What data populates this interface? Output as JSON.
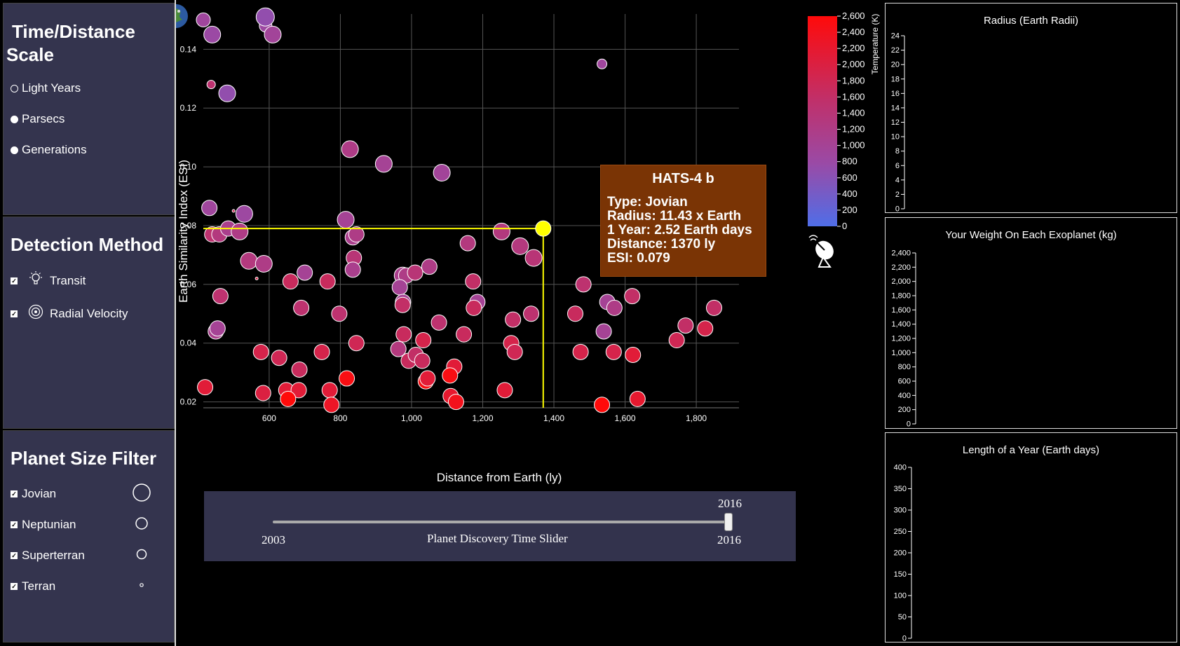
{
  "scale_panel": {
    "title": "Time/Distance Scale",
    "title_line1": "Time/Distance",
    "title_line2": "Scale",
    "options": [
      {
        "label": "Light Years",
        "selected": true
      },
      {
        "label": "Parsecs",
        "selected": false
      },
      {
        "label": "Generations",
        "selected": false
      }
    ]
  },
  "detection_panel": {
    "title": "Detection Method",
    "options": [
      {
        "label": "Transit",
        "checked": true,
        "icon": "lightbulb-icon"
      },
      {
        "label": "Radial Velocity",
        "checked": true,
        "icon": "radial-wave-icon"
      }
    ]
  },
  "size_panel": {
    "title": "Planet Size Filter",
    "options": [
      {
        "label": "Jovian",
        "checked": true
      },
      {
        "label": "Neptunian",
        "checked": true
      },
      {
        "label": "Superterran",
        "checked": true
      },
      {
        "label": "Terran",
        "checked": true
      }
    ]
  },
  "main_chart": {
    "xlabel": "Distance from Earth (ly)",
    "ylabel": "Earth Similarity Index (ESI)",
    "x_ticks": [
      "600",
      "800",
      "1,000",
      "1,200",
      "1,400",
      "1,600",
      "1,800"
    ],
    "y_ticks": [
      "0.02",
      "0.04",
      "0.06",
      "0.08",
      "0.10",
      "0.12",
      "0.14"
    ],
    "colorbar_label": "Temperature (K)",
    "colorbar_ticks": [
      "0",
      "200",
      "400",
      "600",
      "800",
      "1,000",
      "1,200",
      "1,400",
      "1,600",
      "1,800",
      "2,000",
      "2,200",
      "2,400",
      "2,600"
    ],
    "colors": {
      "cold": "#4f6ee8",
      "mid": "#a04aa0",
      "hot": "#ff0a0a",
      "highlight": "#ffff00"
    }
  },
  "tooltip": {
    "name": "HATS-4 b",
    "type": "Type: Jovian",
    "radius": "Radius: 11.43 x Earth",
    "year": "1 Year: 2.52 Earth days",
    "distance": "Distance: 1370 ly",
    "esi": "ESI: 0.079"
  },
  "slider": {
    "label": "Planet Discovery Time Slider",
    "min": "2003",
    "max": "2016",
    "current": "2016",
    "value_fraction": 1.0
  },
  "radius_chart": {
    "title": "Radius (Earth Radii)",
    "ticks": [
      "0",
      "2",
      "4",
      "6",
      "8",
      "10",
      "12",
      "14",
      "16",
      "18",
      "20",
      "22",
      "24"
    ]
  },
  "weight_chart": {
    "title": "Your Weight On Each Exoplanet (kg)",
    "ticks": [
      "0",
      "200",
      "400",
      "600",
      "800",
      "1,000",
      "1,200",
      "1,400",
      "1,600",
      "1,800",
      "2,000",
      "2,200",
      "2,400"
    ]
  },
  "year_chart": {
    "title": "Length of a Year (Earth days)",
    "ticks": [
      "0",
      "50",
      "100",
      "150",
      "200",
      "250",
      "300",
      "350",
      "400"
    ]
  },
  "chart_data": {
    "type": "scatter",
    "xlabel": "Distance from Earth (ly)",
    "ylabel": "Earth Similarity Index (ESI)",
    "xlim": [
      415,
      1920
    ],
    "ylim": [
      0.018,
      0.152
    ],
    "color_scale": "Temperature (K)",
    "color_range": [
      0,
      2600
    ],
    "highlight": {
      "name": "HATS-4 b",
      "x": 1370,
      "y": 0.079,
      "r": 11
    },
    "points": [
      {
        "x": 415,
        "y": 0.15,
        "r": 10,
        "t": 900
      },
      {
        "x": 440,
        "y": 0.145,
        "r": 12,
        "t": 800
      },
      {
        "x": 590,
        "y": 0.148,
        "r": 9,
        "t": 850
      },
      {
        "x": 589,
        "y": 0.151,
        "r": 13,
        "t": 700
      },
      {
        "x": 610,
        "y": 0.145,
        "r": 12,
        "t": 950
      },
      {
        "x": 437,
        "y": 0.128,
        "r": 6,
        "t": 1500
      },
      {
        "x": 482,
        "y": 0.125,
        "r": 12,
        "t": 700
      },
      {
        "x": 1535,
        "y": 0.135,
        "r": 7,
        "t": 900
      },
      {
        "x": 827,
        "y": 0.106,
        "r": 12,
        "t": 1200
      },
      {
        "x": 922,
        "y": 0.101,
        "r": 12,
        "t": 1000
      },
      {
        "x": 1085,
        "y": 0.098,
        "r": 12,
        "t": 950
      },
      {
        "x": 432,
        "y": 0.086,
        "r": 11,
        "t": 900
      },
      {
        "x": 500,
        "y": 0.085,
        "r": 2,
        "t": 1800
      },
      {
        "x": 530,
        "y": 0.084,
        "r": 12,
        "t": 850
      },
      {
        "x": 815,
        "y": 0.082,
        "r": 12,
        "t": 1000
      },
      {
        "x": 440,
        "y": 0.077,
        "r": 11,
        "t": 1500
      },
      {
        "x": 460,
        "y": 0.077,
        "r": 11,
        "t": 1300
      },
      {
        "x": 485,
        "y": 0.079,
        "r": 11,
        "t": 1100
      },
      {
        "x": 517,
        "y": 0.078,
        "r": 12,
        "t": 1200
      },
      {
        "x": 835,
        "y": 0.076,
        "r": 11,
        "t": 1100
      },
      {
        "x": 845,
        "y": 0.077,
        "r": 11,
        "t": 1200
      },
      {
        "x": 1253,
        "y": 0.078,
        "r": 12,
        "t": 1300
      },
      {
        "x": 1305,
        "y": 0.073,
        "r": 12,
        "t": 1300
      },
      {
        "x": 1343,
        "y": 0.069,
        "r": 12,
        "t": 1400
      },
      {
        "x": 1158,
        "y": 0.074,
        "r": 11,
        "t": 1300
      },
      {
        "x": 1672,
        "y": 0.076,
        "r": 12,
        "t": 1600
      },
      {
        "x": 1795,
        "y": 0.07,
        "r": 7,
        "t": 1700
      },
      {
        "x": 543,
        "y": 0.068,
        "r": 12,
        "t": 1300
      },
      {
        "x": 585,
        "y": 0.067,
        "r": 12,
        "t": 1200
      },
      {
        "x": 838,
        "y": 0.069,
        "r": 11,
        "t": 1400
      },
      {
        "x": 835,
        "y": 0.065,
        "r": 11,
        "t": 1100
      },
      {
        "x": 1050,
        "y": 0.066,
        "r": 11,
        "t": 1200
      },
      {
        "x": 565,
        "y": 0.062,
        "r": 2,
        "t": 1900
      },
      {
        "x": 660,
        "y": 0.061,
        "r": 11,
        "t": 1700
      },
      {
        "x": 700,
        "y": 0.064,
        "r": 11,
        "t": 1000
      },
      {
        "x": 764,
        "y": 0.061,
        "r": 11,
        "t": 1700
      },
      {
        "x": 975,
        "y": 0.063,
        "r": 12,
        "t": 1100
      },
      {
        "x": 985,
        "y": 0.063,
        "r": 11,
        "t": 1200
      },
      {
        "x": 1010,
        "y": 0.064,
        "r": 11,
        "t": 1400
      },
      {
        "x": 967,
        "y": 0.059,
        "r": 11,
        "t": 1000
      },
      {
        "x": 1173,
        "y": 0.061,
        "r": 11,
        "t": 1600
      },
      {
        "x": 1483,
        "y": 0.06,
        "r": 11,
        "t": 1500
      },
      {
        "x": 463,
        "y": 0.056,
        "r": 11,
        "t": 1500
      },
      {
        "x": 690,
        "y": 0.052,
        "r": 11,
        "t": 1500
      },
      {
        "x": 797,
        "y": 0.05,
        "r": 11,
        "t": 1500
      },
      {
        "x": 976,
        "y": 0.054,
        "r": 11,
        "t": 1000
      },
      {
        "x": 975,
        "y": 0.053,
        "r": 11,
        "t": 1600
      },
      {
        "x": 1185,
        "y": 0.054,
        "r": 11,
        "t": 1000
      },
      {
        "x": 1175,
        "y": 0.052,
        "r": 11,
        "t": 1700
      },
      {
        "x": 1336,
        "y": 0.05,
        "r": 11,
        "t": 1500
      },
      {
        "x": 1460,
        "y": 0.05,
        "r": 11,
        "t": 1700
      },
      {
        "x": 1550,
        "y": 0.054,
        "r": 11,
        "t": 1000
      },
      {
        "x": 1570,
        "y": 0.052,
        "r": 11,
        "t": 1200
      },
      {
        "x": 1620,
        "y": 0.056,
        "r": 11,
        "t": 1600
      },
      {
        "x": 1850,
        "y": 0.052,
        "r": 11,
        "t": 1600
      },
      {
        "x": 450,
        "y": 0.044,
        "r": 11,
        "t": 1100
      },
      {
        "x": 455,
        "y": 0.045,
        "r": 11,
        "t": 1000
      },
      {
        "x": 1077,
        "y": 0.047,
        "r": 11,
        "t": 1500
      },
      {
        "x": 1285,
        "y": 0.048,
        "r": 11,
        "t": 1600
      },
      {
        "x": 1540,
        "y": 0.044,
        "r": 11,
        "t": 1000
      },
      {
        "x": 1770,
        "y": 0.046,
        "r": 11,
        "t": 1600
      },
      {
        "x": 1825,
        "y": 0.045,
        "r": 11,
        "t": 1900
      },
      {
        "x": 978,
        "y": 0.043,
        "r": 11,
        "t": 1700
      },
      {
        "x": 1033,
        "y": 0.041,
        "r": 11,
        "t": 1900
      },
      {
        "x": 1147,
        "y": 0.043,
        "r": 11,
        "t": 1700
      },
      {
        "x": 845,
        "y": 0.04,
        "r": 11,
        "t": 1800
      },
      {
        "x": 963,
        "y": 0.038,
        "r": 11,
        "t": 1300
      },
      {
        "x": 1280,
        "y": 0.04,
        "r": 11,
        "t": 1900
      },
      {
        "x": 1290,
        "y": 0.037,
        "r": 11,
        "t": 1800
      },
      {
        "x": 1475,
        "y": 0.037,
        "r": 11,
        "t": 1900
      },
      {
        "x": 1568,
        "y": 0.037,
        "r": 11,
        "t": 1900
      },
      {
        "x": 1745,
        "y": 0.041,
        "r": 11,
        "t": 1800
      },
      {
        "x": 577,
        "y": 0.037,
        "r": 11,
        "t": 1900
      },
      {
        "x": 628,
        "y": 0.035,
        "r": 11,
        "t": 1800
      },
      {
        "x": 748,
        "y": 0.037,
        "r": 11,
        "t": 1900
      },
      {
        "x": 685,
        "y": 0.031,
        "r": 11,
        "t": 1700
      },
      {
        "x": 992,
        "y": 0.034,
        "r": 11,
        "t": 1700
      },
      {
        "x": 1012,
        "y": 0.036,
        "r": 11,
        "t": 1600
      },
      {
        "x": 1030,
        "y": 0.034,
        "r": 11,
        "t": 1700
      },
      {
        "x": 1120,
        "y": 0.032,
        "r": 11,
        "t": 2100
      },
      {
        "x": 1040,
        "y": 0.027,
        "r": 11,
        "t": 2500
      },
      {
        "x": 1045,
        "y": 0.028,
        "r": 11,
        "t": 2100
      },
      {
        "x": 1108,
        "y": 0.029,
        "r": 11,
        "t": 2500
      },
      {
        "x": 818,
        "y": 0.028,
        "r": 11,
        "t": 2500
      },
      {
        "x": 1622,
        "y": 0.036,
        "r": 11,
        "t": 2100
      },
      {
        "x": 420,
        "y": 0.025,
        "r": 11,
        "t": 2100
      },
      {
        "x": 583,
        "y": 0.023,
        "r": 11,
        "t": 2000
      },
      {
        "x": 648,
        "y": 0.024,
        "r": 11,
        "t": 2100
      },
      {
        "x": 683,
        "y": 0.024,
        "r": 11,
        "t": 2100
      },
      {
        "x": 653,
        "y": 0.021,
        "r": 11,
        "t": 2600
      },
      {
        "x": 770,
        "y": 0.024,
        "r": 11,
        "t": 2100
      },
      {
        "x": 775,
        "y": 0.019,
        "r": 11,
        "t": 2300
      },
      {
        "x": 1110,
        "y": 0.022,
        "r": 11,
        "t": 2200
      },
      {
        "x": 1125,
        "y": 0.02,
        "r": 11,
        "t": 2400
      },
      {
        "x": 1262,
        "y": 0.024,
        "r": 11,
        "t": 2100
      },
      {
        "x": 1535,
        "y": 0.019,
        "r": 11,
        "t": 2600
      },
      {
        "x": 1635,
        "y": 0.021,
        "r": 11,
        "t": 2200
      }
    ]
  }
}
